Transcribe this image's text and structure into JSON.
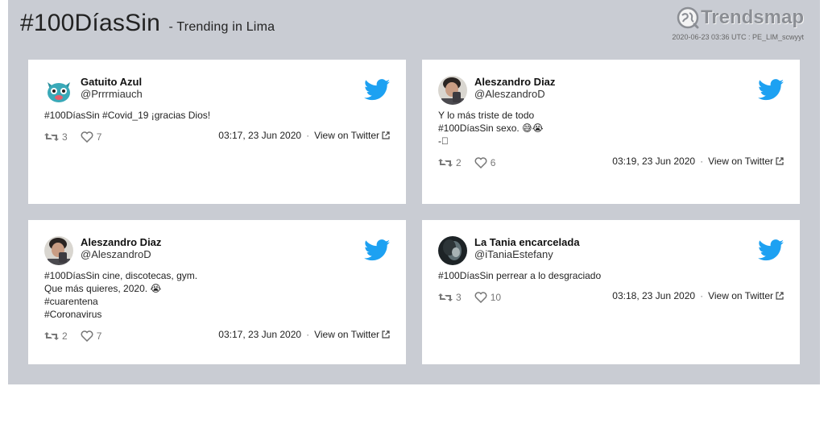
{
  "header": {
    "hashtag": "#100DíasSin",
    "subtitle": "- Trending in Lima",
    "brand": "Trendsmap",
    "meta": "2020-06-23 03:36 UTC : PE_LIM_scwyyt"
  },
  "colors": {
    "panel_bg": "#c9ccd3",
    "twitter_blue": "#1da1f2",
    "icon_gray": "#777777"
  },
  "icons": {
    "brand": "trendsmap-globe-logo",
    "retweet": "retweet-icon",
    "like": "heart-icon",
    "twitter": "twitter-bird-icon",
    "external": "external-link-icon"
  },
  "tweets": [
    {
      "name": "Gatuito Azul",
      "handle": "@Prrrmiauch",
      "lines": [
        "#100DíasSin #Covid_19 ¡gracias Dios!"
      ],
      "retweets": "3",
      "likes": "7",
      "time": "03:17, 23 Jun 2020",
      "link": "View on Twitter"
    },
    {
      "name": "Aleszandro Diaz",
      "handle": "@AleszandroD",
      "lines": [
        "Y lo más triste de todo",
        "#100DíasSin sexo. 😅😭",
        "-🏻"
      ],
      "retweets": "2",
      "likes": "6",
      "time": "03:19, 23 Jun 2020",
      "link": "View on Twitter"
    },
    {
      "name": "Aleszandro Diaz",
      "handle": "@AleszandroD",
      "lines": [
        "#100DíasSin cine, discotecas, gym.",
        "Que más quieres, 2020. 😭",
        "#cuarentena",
        "#Coronavirus"
      ],
      "retweets": "2",
      "likes": "7",
      "time": "03:17, 23 Jun 2020",
      "link": "View on Twitter"
    },
    {
      "name": "La Tania encarcelada",
      "handle": "@iTaniaEstefany",
      "lines": [
        "#100DíasSin perrear a lo desgraciado"
      ],
      "retweets": "3",
      "likes": "10",
      "time": "03:18, 23 Jun 2020",
      "link": "View on Twitter"
    }
  ]
}
